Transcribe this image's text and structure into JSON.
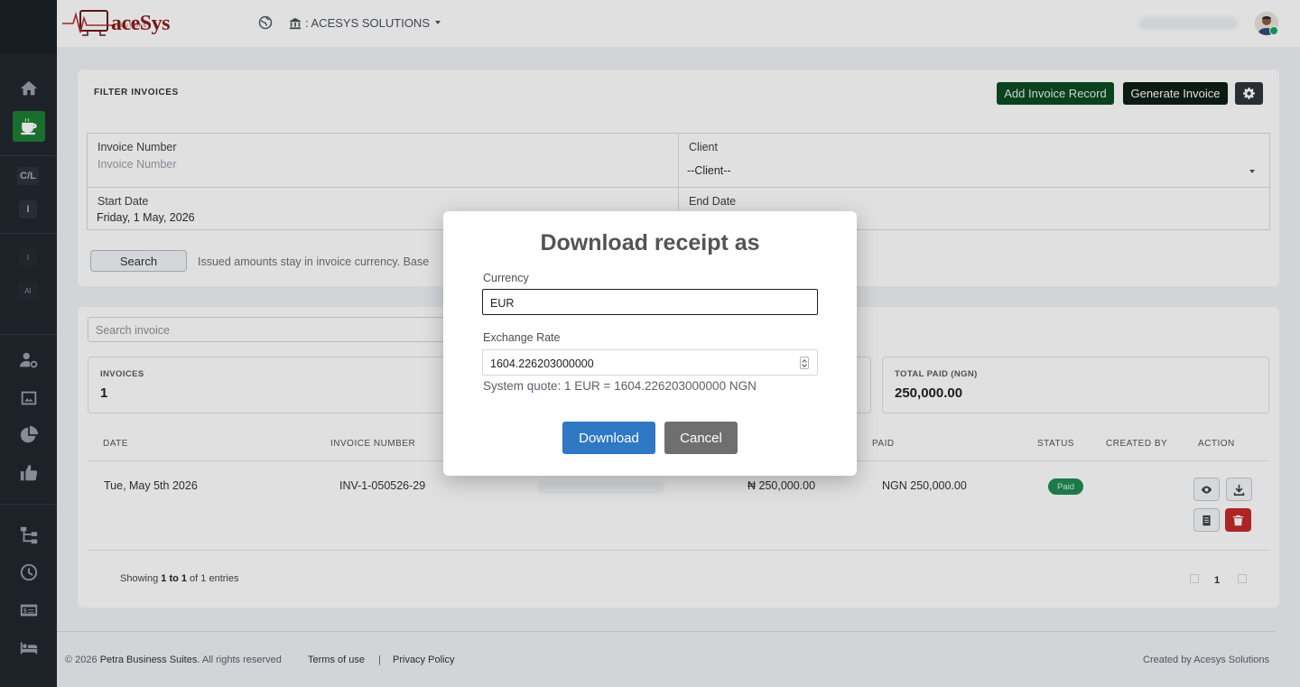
{
  "brand": {
    "name": "aceSys",
    "sub": "SOLUTIONS"
  },
  "header": {
    "company": ": ACESYS SOLUTIONS"
  },
  "sidebar": {
    "chips": [
      "C/L",
      "I",
      "I",
      "AI"
    ]
  },
  "filter": {
    "title": "FILTER INVOICES",
    "add_label": "Add Invoice Record",
    "generate_label": "Generate Invoice",
    "invoice_number_label": "Invoice Number",
    "invoice_number_placeholder": "Invoice Number",
    "client_label": "Client",
    "client_value": "--Client--",
    "start_date_label": "Start Date",
    "start_date_value": "Friday, 1 May, 2026",
    "end_date_label": "End Date",
    "search_label": "Search",
    "note": "Issued amounts stay in invoice currency. Base"
  },
  "table": {
    "search_placeholder": "Search invoice",
    "stats": [
      {
        "label": "INVOICES",
        "value": "1"
      },
      {
        "label": "TOTAL PAID (NGN)",
        "value": "250,000.00"
      }
    ],
    "headers": {
      "date": "DATE",
      "invoice_number": "INVOICE NUMBER",
      "paid": "PAID",
      "status": "STATUS",
      "created_by": "CREATED BY",
      "action": "ACTION"
    },
    "rows": [
      {
        "date": "Tue, May 5th 2026",
        "invoice_number": "INV-1-050526-29",
        "amount": "₦ 250,000.00",
        "paid": "NGN 250,000.00",
        "status": "Paid"
      }
    ],
    "showing_prefix": "Showing ",
    "showing_range": "1 to 1",
    "showing_suffix": " of 1 entries",
    "page": "1"
  },
  "footer": {
    "copyright": "© 2026 ",
    "company": "Petra Business Suites",
    "rights": ". All rights reserved",
    "terms": "Terms of use",
    "separator": "|",
    "privacy": "Privacy Policy",
    "created_by": "Created by Acesys Solutions"
  },
  "modal": {
    "title": "Download receipt as",
    "currency_label": "Currency",
    "currency_value": "EUR",
    "rate_label": "Exchange Rate",
    "rate_value": "1604.226203000000",
    "quote": "System quote: 1 EUR = 1604.226203000000 NGN",
    "download_label": "Download",
    "cancel_label": "Cancel"
  },
  "colors": {
    "accent_green": "#0c4b24",
    "primary_blue": "#2f78c4",
    "danger": "#c62828",
    "paid_badge": "#1f8a55"
  }
}
